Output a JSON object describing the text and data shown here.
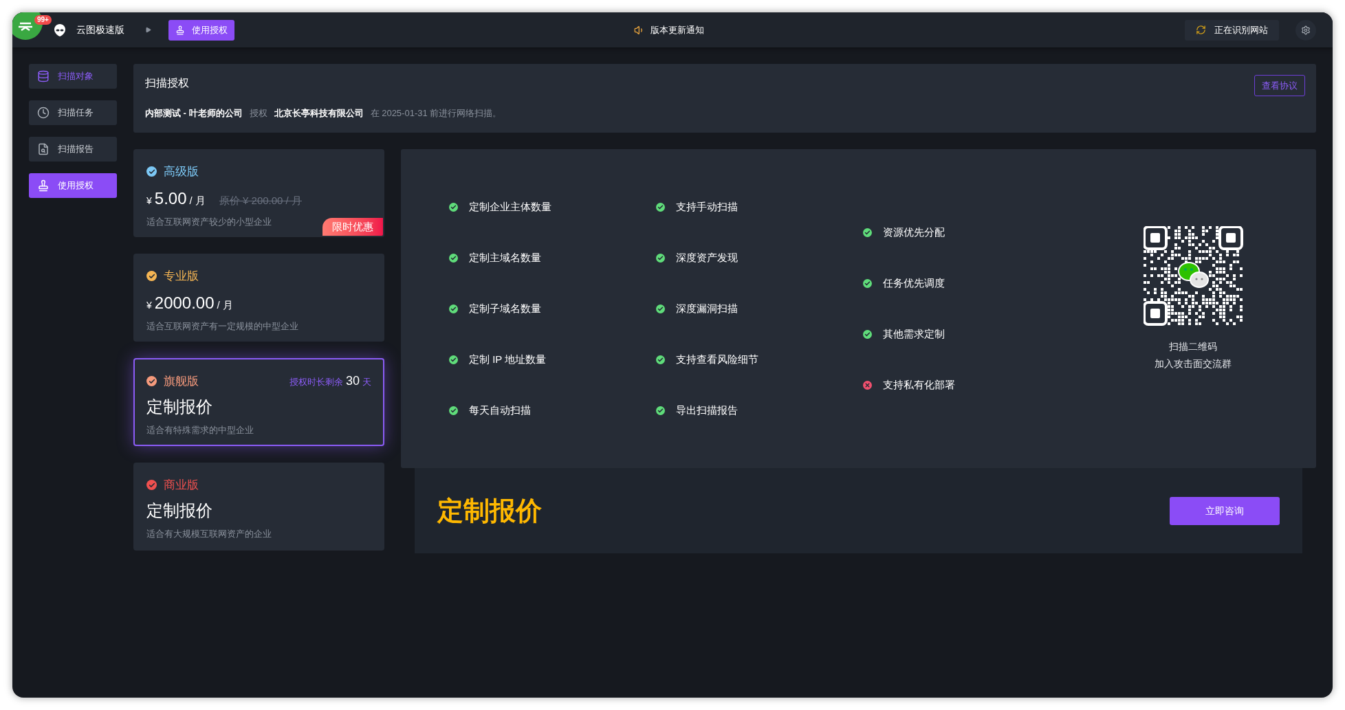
{
  "top_bar": {
    "badge": "99+",
    "app_name": "云图极速版",
    "breadcrumb": "使用授权",
    "notice": "版本更新通知",
    "status": "正在识别网站"
  },
  "sidebar": {
    "items": [
      {
        "label": "扫描对象",
        "kind": "database",
        "selected": false,
        "highlighted": true
      },
      {
        "label": "扫描任务",
        "kind": "clock",
        "selected": false,
        "highlighted": false
      },
      {
        "label": "扫描报告",
        "kind": "report",
        "selected": false,
        "highlighted": false
      },
      {
        "label": "使用授权",
        "kind": "stamp",
        "selected": true,
        "highlighted": false
      }
    ]
  },
  "header": {
    "title": "扫描授权",
    "button": "查看协议",
    "licensee": "内部测试 - 叶老师的公司",
    "verb": "授权",
    "licensor": "北京长亭科技有限公司",
    "note": "在 2025-01-31 前进行网络扫描。"
  },
  "plans": [
    {
      "name": "高级版",
      "color": "#7cc8f5",
      "kind": "price",
      "selected": false,
      "currency": "¥",
      "amount": "5.00",
      "unit": "/ 月",
      "original": "原价 ¥ 200.00 / 月",
      "badge": "限时优惠",
      "description": "适合互联网资产较少的小型企业"
    },
    {
      "name": "专业版",
      "color": "#f5b553",
      "kind": "price",
      "selected": false,
      "currency": "¥",
      "amount": "2000.00",
      "unit": "/ 月",
      "description": "适合互联网资产有一定规模的中型企业"
    },
    {
      "name": "旗舰版",
      "color": "#f59a7c",
      "kind": "quote",
      "selected": true,
      "quote": "定制报价",
      "remaining": {
        "prefix": "授权时长剩余",
        "days": "30",
        "suffix": "天"
      },
      "description": "适合有特殊需求的中型企业"
    },
    {
      "name": "商业版",
      "color": "#f0504f",
      "kind": "quote",
      "selected": false,
      "quote": "定制报价",
      "description": "适合有大规模互联网资产的企业"
    }
  ],
  "features": {
    "columns": [
      [
        {
          "label": "定制企业主体数量",
          "included": true
        },
        {
          "label": "定制主域名数量",
          "included": true
        },
        {
          "label": "定制子域名数量",
          "included": true
        },
        {
          "label": "定制 IP 地址数量",
          "included": true
        },
        {
          "label": "每天自动扫描",
          "included": true
        }
      ],
      [
        {
          "label": "支持手动扫描",
          "included": true
        },
        {
          "label": "深度资产发现",
          "included": true
        },
        {
          "label": "深度漏洞扫描",
          "included": true
        },
        {
          "label": "支持查看风险细节",
          "included": true
        },
        {
          "label": "导出扫描报告",
          "included": true
        }
      ],
      [
        {
          "label": "资源优先分配",
          "included": true
        },
        {
          "label": "任务优先调度",
          "included": true
        },
        {
          "label": "其他需求定制",
          "included": true
        },
        {
          "label": "支持私有化部署",
          "included": false
        }
      ]
    ],
    "qr_caption": [
      "扫描二维码",
      "加入攻击面交流群"
    ]
  },
  "footer": {
    "price": "定制报价",
    "button": "立即咨询"
  }
}
